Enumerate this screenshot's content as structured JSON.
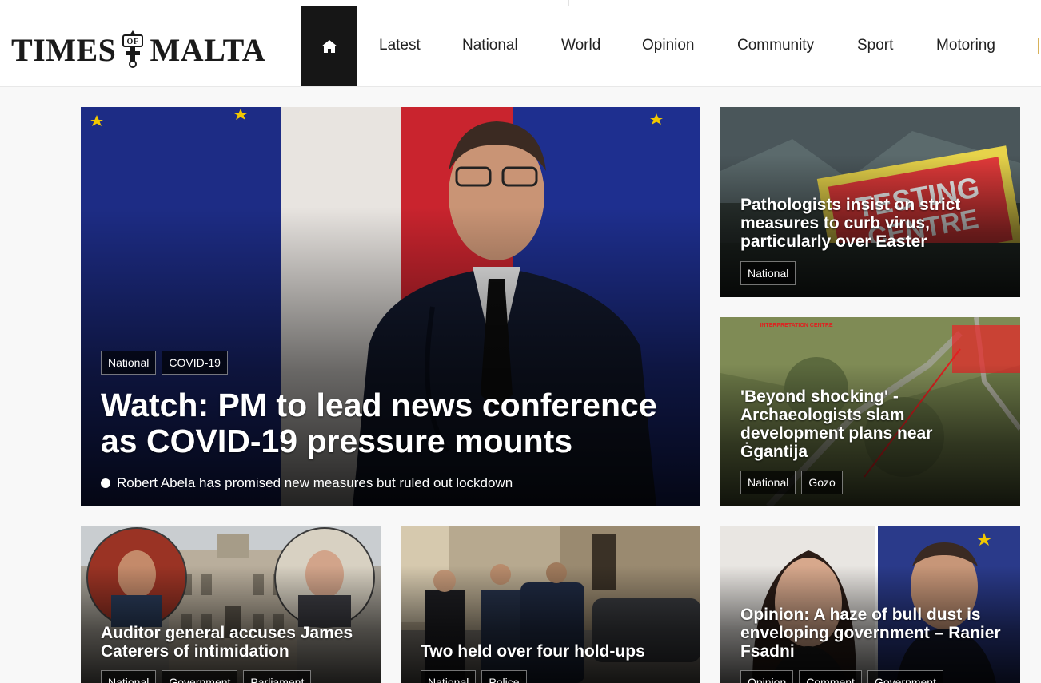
{
  "brand": {
    "logo_left": "TIMES",
    "logo_of": "OF",
    "logo_right": "MALTA"
  },
  "nav": {
    "home_icon": "home-icon",
    "items": [
      "Latest",
      "National",
      "World",
      "Opinion",
      "Community",
      "Sport",
      "Motoring"
    ]
  },
  "main_story": {
    "tags": [
      "National",
      "COVID-19"
    ],
    "headline": "Watch: PM to lead news conference as COVID-19 pressure mounts",
    "summary": "Robert Abela has promised new measures but ruled out lockdown"
  },
  "side_stories": [
    {
      "headline": "Pathologists insist on strict measures to curb virus, particularly over Easter",
      "tags": [
        "National"
      ],
      "image_sign": "TESTING CENTRE"
    },
    {
      "headline": "'Beyond shocking' - Archaeologists slam development plans near Ġgantija",
      "tags": [
        "National",
        "Gozo"
      ],
      "image_label": "INTERPRETATION CENTRE"
    }
  ],
  "bottom_stories": [
    {
      "headline": "Auditor general accuses James Caterers of intimidation",
      "tags": [
        "National",
        "Government",
        "Parliament"
      ]
    },
    {
      "headline": "Two held over four hold-ups",
      "tags": [
        "National",
        "Police"
      ]
    },
    {
      "headline": "Opinion: A haze of bull dust is enveloping government – Ranier Fsadni",
      "tags": [
        "Opinion",
        "Comment",
        "Government"
      ]
    }
  ],
  "colors": {
    "header_bg": "#ffffff",
    "home_tab_bg": "#161616",
    "page_bg": "#f8f8f8"
  }
}
